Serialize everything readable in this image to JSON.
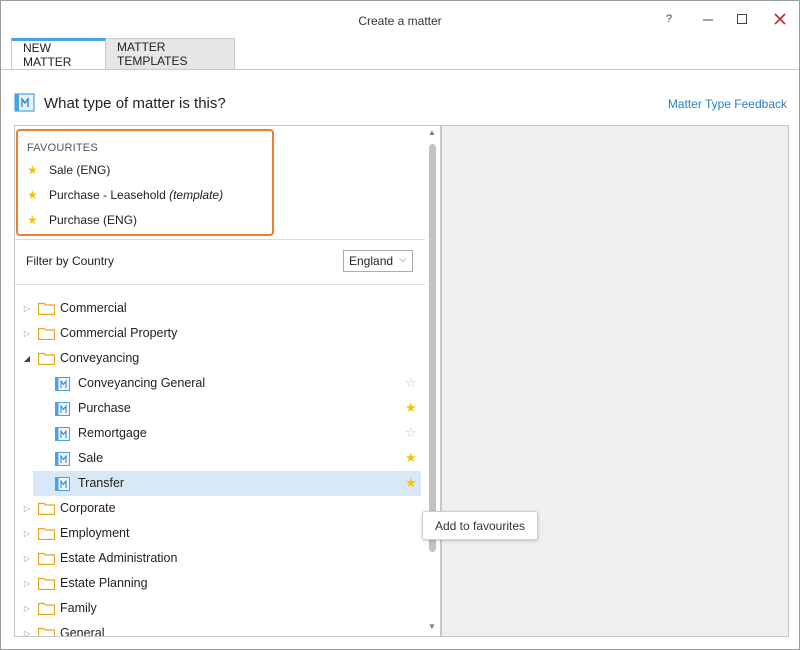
{
  "window": {
    "title": "Create a matter",
    "controls": {
      "help": "?",
      "minimize": "—",
      "maximize": "☐",
      "close": "✕"
    }
  },
  "tabs": [
    {
      "label": "NEW MATTER",
      "active": true
    },
    {
      "label": "MATTER TEMPLATES",
      "active": false
    }
  ],
  "header": {
    "question": "What type of matter is this?",
    "feedback_link": "Matter Type Feedback",
    "icon": "matter-type-icon"
  },
  "favourites": {
    "title": "FAVOURITES",
    "items": [
      {
        "label": "Sale (ENG)",
        "suffix": ""
      },
      {
        "label": "Purchase - Leasehold ",
        "suffix": "(template)"
      },
      {
        "label": "Purchase (ENG)",
        "suffix": ""
      }
    ]
  },
  "filter": {
    "label": "Filter by Country",
    "selected": "England"
  },
  "tree": {
    "nodes": [
      {
        "label": "Commercial",
        "type": "folder",
        "expanded": false
      },
      {
        "label": "Commercial Property",
        "type": "folder",
        "expanded": false
      },
      {
        "label": "Conveyancing",
        "type": "folder",
        "expanded": true
      },
      {
        "label": "Conveyancing General",
        "type": "matter",
        "favourite": false
      },
      {
        "label": "Purchase",
        "type": "matter",
        "favourite": true
      },
      {
        "label": "Remortgage",
        "type": "matter",
        "favourite": false
      },
      {
        "label": "Sale",
        "type": "matter",
        "favourite": true
      },
      {
        "label": "Transfer",
        "type": "matter",
        "favourite": true,
        "selected": true
      },
      {
        "label": "Corporate",
        "type": "folder",
        "expanded": false
      },
      {
        "label": "Employment",
        "type": "folder",
        "expanded": false
      },
      {
        "label": "Estate Administration",
        "type": "folder",
        "expanded": false
      },
      {
        "label": "Estate Planning",
        "type": "folder",
        "expanded": false
      },
      {
        "label": "Family",
        "type": "folder",
        "expanded": false
      },
      {
        "label": "General",
        "type": "folder",
        "expanded": false
      }
    ]
  },
  "tooltip": "Add to favourites",
  "colors": {
    "accent": "#4aa3df",
    "link": "#2a7fc1",
    "favourite_highlight": "#ed7d31",
    "star": "#f2c500",
    "folder": "#e8a317",
    "selected_row": "#d9e8f7",
    "close_button": "#c42b1c"
  }
}
